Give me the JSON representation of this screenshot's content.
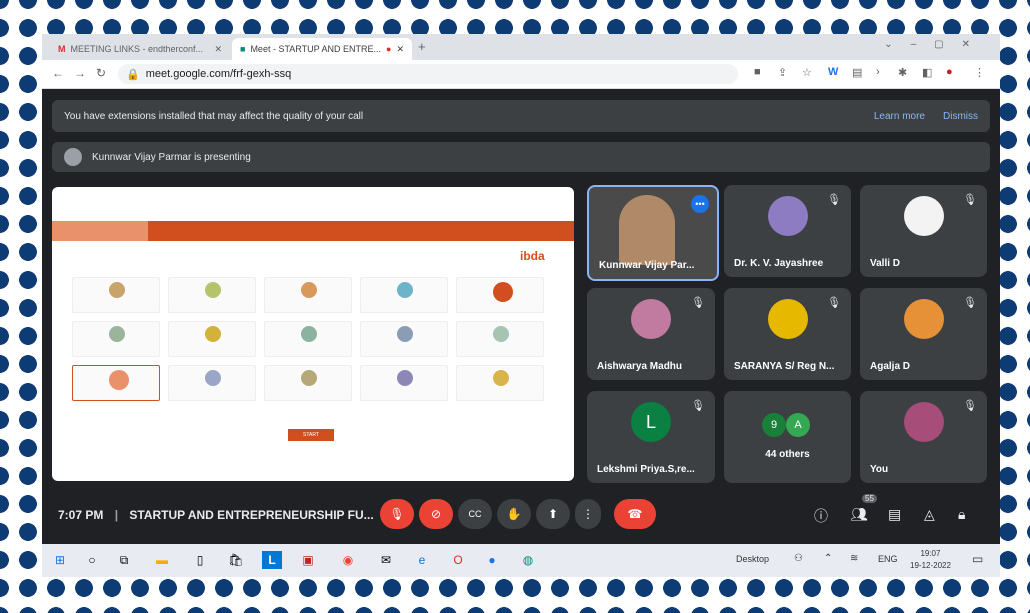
{
  "browser": {
    "tabs": [
      {
        "label": "MEETING LINKS - endtherconf..."
      },
      {
        "label": "Meet - STARTUP AND ENTRE..."
      }
    ],
    "url": "meet.google.com/frf-gexh-ssq"
  },
  "banner": {
    "text": "You have extensions installed that may affect the quality of your call",
    "learn_more": "Learn more",
    "dismiss": "Dismiss"
  },
  "presenting": {
    "text": "Kunnwar Vijay Parmar is presenting"
  },
  "participants": [
    {
      "name": "Kunnwar Vijay Par...",
      "color": "#5f6368"
    },
    {
      "name": "Dr. K. V. Jayashree",
      "color": "#8e7cc3"
    },
    {
      "name": "Valli D",
      "color": "#f3f3f3"
    },
    {
      "name": "Aishwarya Madhu",
      "color": "#c27ba0"
    },
    {
      "name": "SARANYA S/ Reg N...",
      "color": "#e6b800"
    },
    {
      "name": "Agalja D",
      "color": "#e69138"
    },
    {
      "name": "Lekshmi Priya.S,re...",
      "initial": "L",
      "color": "#0b8043"
    },
    {
      "name": "44 others",
      "initials": [
        "9",
        "A"
      ],
      "color": "#188038"
    },
    {
      "name": "You",
      "color": "#a64d79"
    }
  ],
  "bottom": {
    "time": "7:07 PM",
    "meeting": "STARTUP AND ENTREPRENEURSHIP FU...",
    "participant_count": "55"
  },
  "taskbar": {
    "desktop": "Desktop",
    "lang": "ENG",
    "time": "19:07",
    "date": "19-12-2022"
  },
  "share": {
    "brand": "ibda",
    "btn": "START"
  }
}
